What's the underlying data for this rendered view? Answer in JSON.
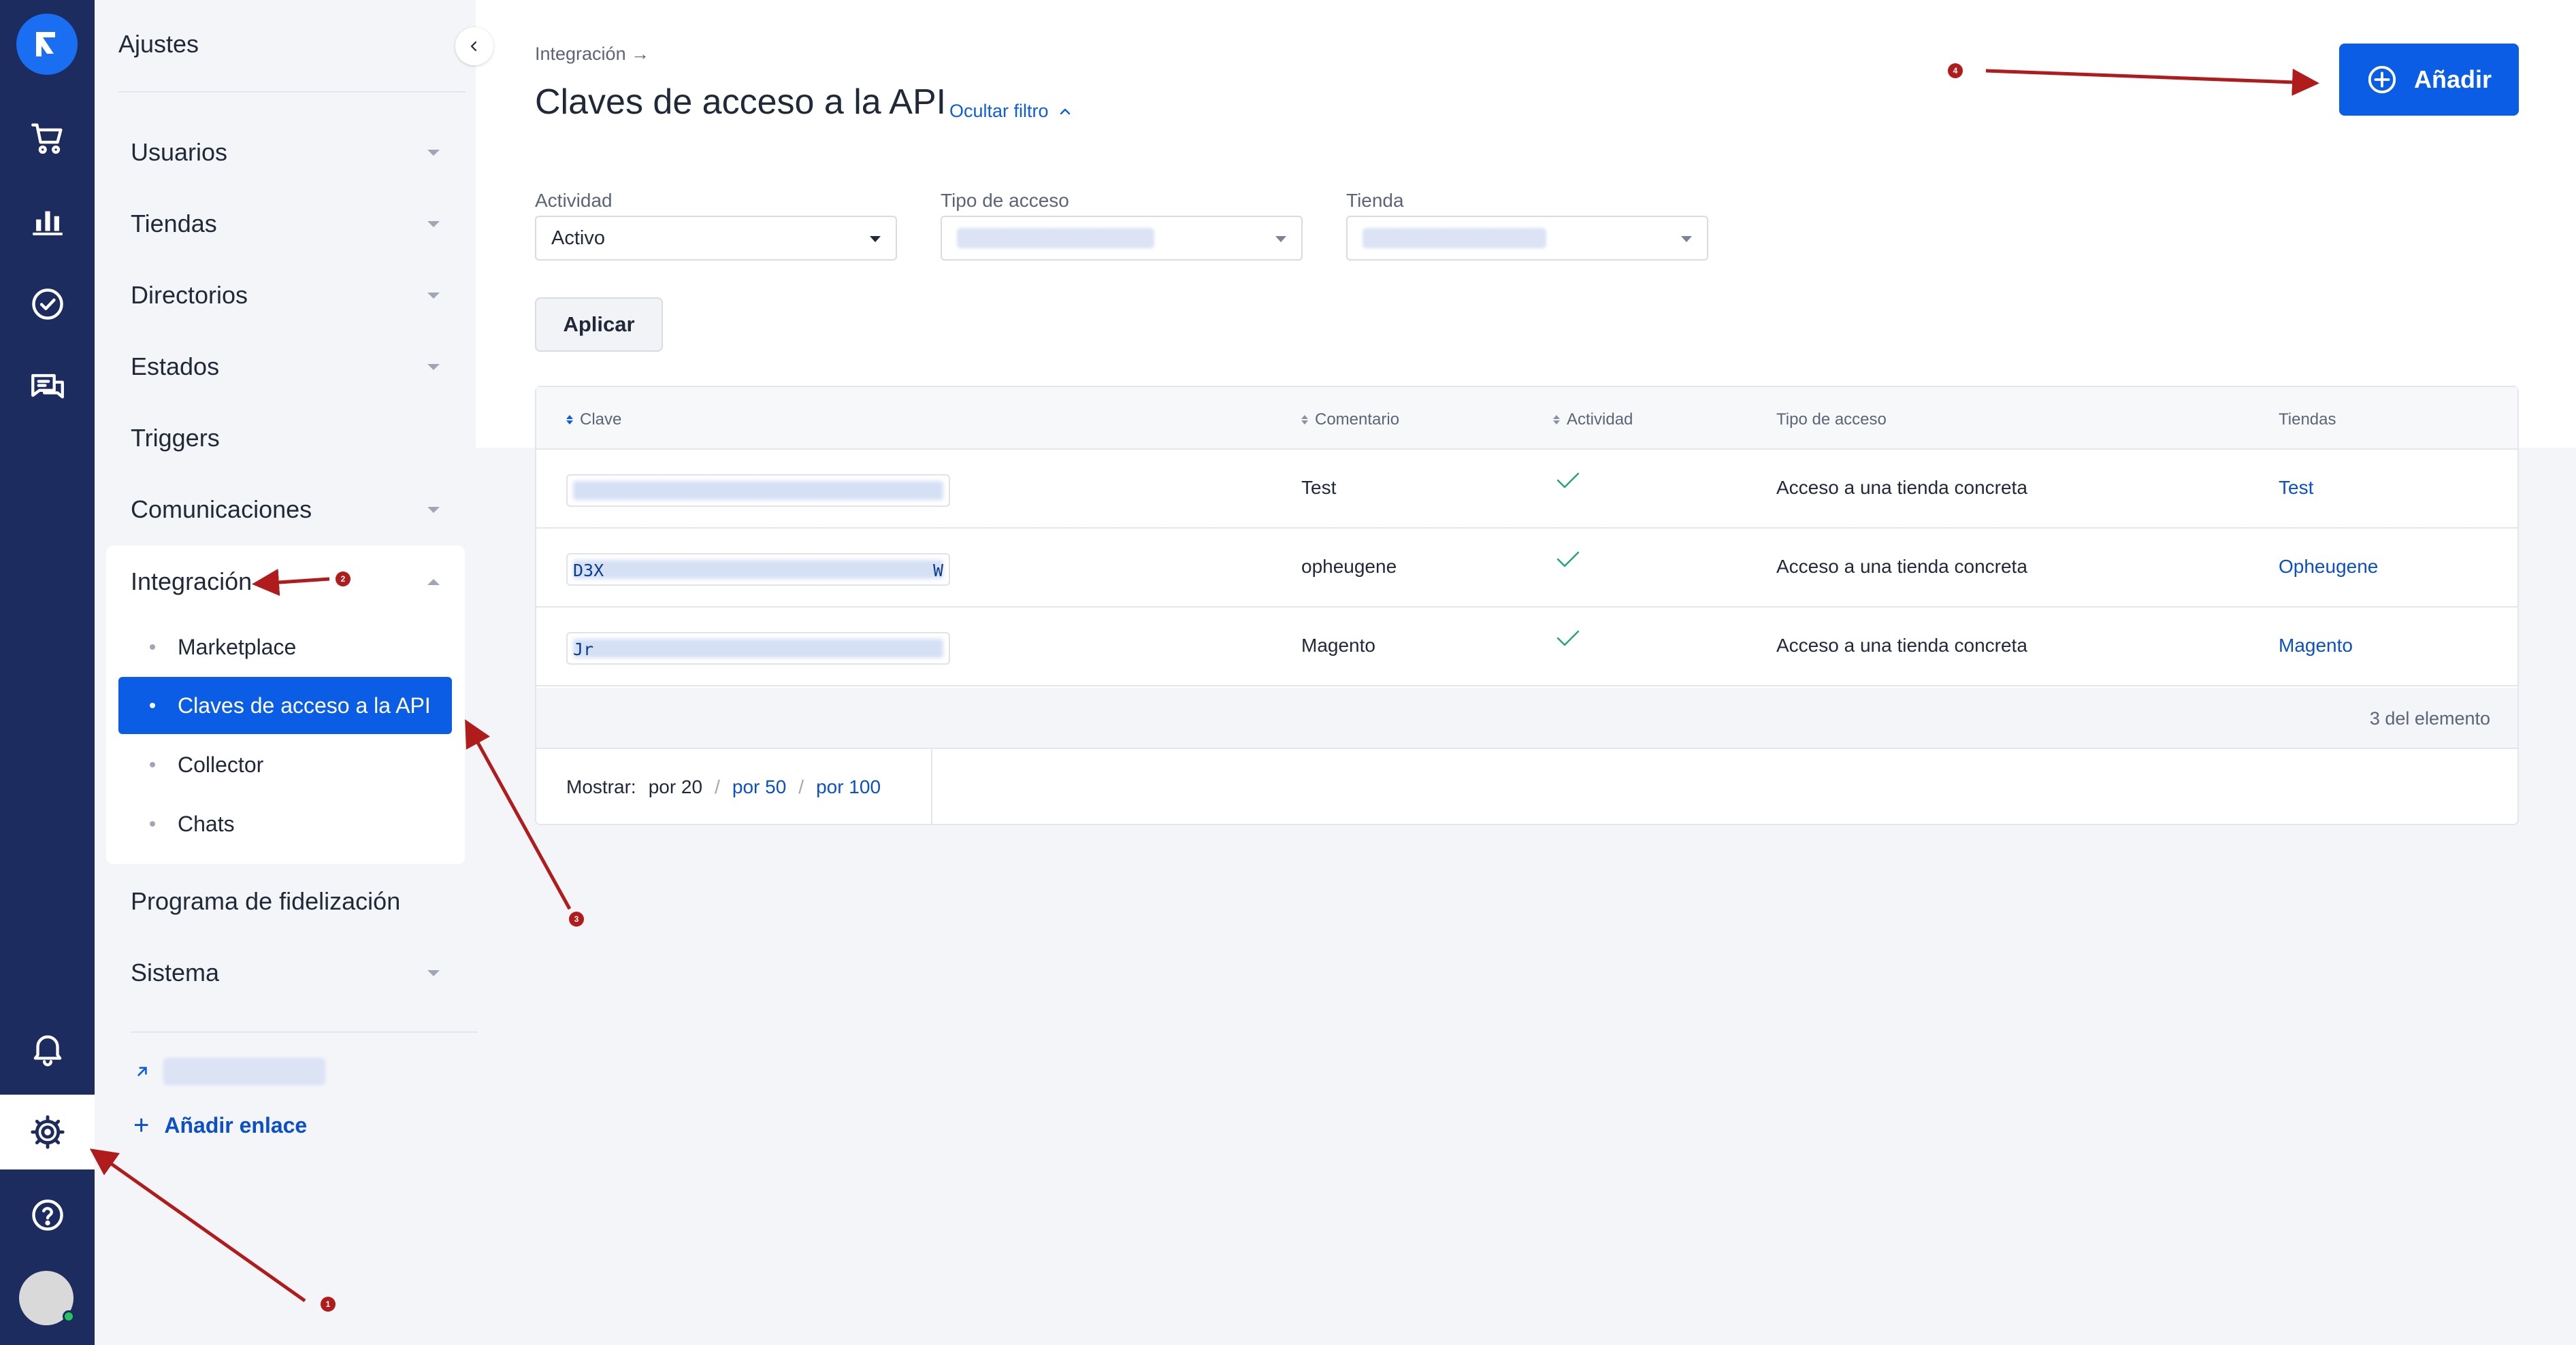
{
  "colors": {
    "accent": "#0b5de6",
    "rail": "#1d2c5f",
    "annotation": "#b01c1c",
    "check": "#22a37a"
  },
  "rail": {
    "logo_icon": "brand-logo-icon",
    "items": [
      {
        "name": "cart-icon"
      },
      {
        "name": "analytics-icon"
      },
      {
        "name": "tasks-check-icon"
      },
      {
        "name": "chat-icon"
      }
    ],
    "bottom_items": [
      {
        "name": "bell-icon"
      },
      {
        "name": "gear-icon",
        "active": true
      },
      {
        "name": "help-icon"
      }
    ]
  },
  "sidebar": {
    "title": "Ajustes",
    "items": [
      {
        "label": "Usuarios",
        "has_caret": true
      },
      {
        "label": "Tiendas",
        "has_caret": true
      },
      {
        "label": "Directorios",
        "has_caret": true
      },
      {
        "label": "Estados",
        "has_caret": true
      },
      {
        "label": "Triggers",
        "has_caret": false
      },
      {
        "label": "Comunicaciones",
        "has_caret": true
      },
      {
        "label": "Integración",
        "expanded": true
      },
      {
        "label": "Programa de fidelización",
        "has_caret": false
      },
      {
        "label": "Sistema",
        "has_caret": true
      }
    ],
    "sub_items": [
      {
        "label": "Marketplace"
      },
      {
        "label": "Claves de acceso a la API",
        "active": true
      },
      {
        "label": "Collector"
      },
      {
        "label": "Chats"
      }
    ],
    "add_link_label": "Añadir enlace"
  },
  "header": {
    "breadcrumb": "Integración →",
    "title": "Claves de acceso a la API",
    "toggle_filter": "Ocultar filtro",
    "add_button": "Añadir"
  },
  "filters": {
    "activity": {
      "label": "Actividad",
      "value": "Activo"
    },
    "access_type": {
      "label": "Tipo de acceso",
      "value": ""
    },
    "store": {
      "label": "Tienda",
      "value": ""
    },
    "apply": "Aplicar"
  },
  "table": {
    "headers": [
      "Clave",
      "Comentario",
      "Actividad",
      "Tipo de acceso",
      "Tiendas"
    ],
    "rows": [
      {
        "key_prefix": "",
        "key_suffix": "",
        "comment": "Test",
        "active": true,
        "access": "Acceso a una tienda concreta",
        "store": "Test"
      },
      {
        "key_prefix": "D3X",
        "key_suffix": "W",
        "comment": "opheugene",
        "active": true,
        "access": "Acceso a una tienda concreta",
        "store": "Opheugene"
      },
      {
        "key_prefix": "Jr",
        "key_suffix": "",
        "comment": "Magento",
        "active": true,
        "access": "Acceso a una tienda concreta",
        "store": "Magento"
      }
    ],
    "count_text": "3 del elemento",
    "pager": {
      "label": "Mostrar:",
      "current": "por 20",
      "options": [
        "por 50",
        "por 100"
      ]
    }
  },
  "annotations": [
    "1",
    "2",
    "3",
    "4"
  ]
}
